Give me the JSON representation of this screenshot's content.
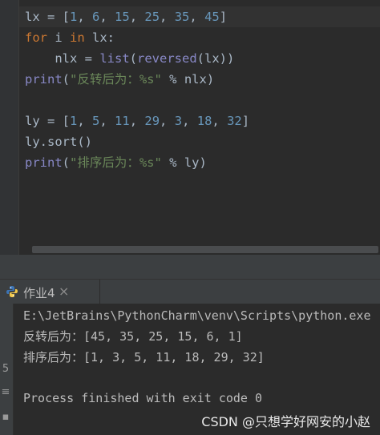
{
  "editor": {
    "lines": [
      {
        "tokens": [
          {
            "t": "lx = [",
            "c": ""
          },
          {
            "t": "1",
            "c": "num"
          },
          {
            "t": ", ",
            "c": ""
          },
          {
            "t": "6",
            "c": "num"
          },
          {
            "t": ", ",
            "c": ""
          },
          {
            "t": "15",
            "c": "num"
          },
          {
            "t": ", ",
            "c": ""
          },
          {
            "t": "25",
            "c": "num"
          },
          {
            "t": ", ",
            "c": ""
          },
          {
            "t": "35",
            "c": "num"
          },
          {
            "t": ", ",
            "c": ""
          },
          {
            "t": "45",
            "c": "num"
          },
          {
            "t": "]",
            "c": ""
          }
        ]
      },
      {
        "tokens": [
          {
            "t": "for",
            "c": "kw"
          },
          {
            "t": " i ",
            "c": ""
          },
          {
            "t": "in",
            "c": "kw"
          },
          {
            "t": " lx:",
            "c": ""
          }
        ]
      },
      {
        "tokens": [
          {
            "t": "    nlx = ",
            "c": ""
          },
          {
            "t": "list",
            "c": "fn"
          },
          {
            "t": "(",
            "c": ""
          },
          {
            "t": "reversed",
            "c": "fn"
          },
          {
            "t": "(lx))",
            "c": ""
          }
        ]
      },
      {
        "tokens": [
          {
            "t": "print",
            "c": "fn"
          },
          {
            "t": "(",
            "c": ""
          },
          {
            "t": "\"反转后为：%s\"",
            "c": "str"
          },
          {
            "t": " % nlx)",
            "c": ""
          }
        ]
      },
      {
        "tokens": []
      },
      {
        "tokens": [
          {
            "t": "ly = [",
            "c": ""
          },
          {
            "t": "1",
            "c": "num"
          },
          {
            "t": ", ",
            "c": ""
          },
          {
            "t": "5",
            "c": "num"
          },
          {
            "t": ", ",
            "c": ""
          },
          {
            "t": "11",
            "c": "num"
          },
          {
            "t": ", ",
            "c": ""
          },
          {
            "t": "29",
            "c": "num"
          },
          {
            "t": ", ",
            "c": ""
          },
          {
            "t": "3",
            "c": "num"
          },
          {
            "t": ", ",
            "c": ""
          },
          {
            "t": "18",
            "c": "num"
          },
          {
            "t": ", ",
            "c": ""
          },
          {
            "t": "32",
            "c": "num"
          },
          {
            "t": "]",
            "c": ""
          }
        ]
      },
      {
        "tokens": [
          {
            "t": "ly.sort()",
            "c": ""
          }
        ]
      },
      {
        "tokens": [
          {
            "t": "print",
            "c": "fn"
          },
          {
            "t": "(",
            "c": ""
          },
          {
            "t": "\"排序后为：%s\"",
            "c": "str"
          },
          {
            "t": " % ly)",
            "c": ""
          }
        ]
      }
    ]
  },
  "run_panel": {
    "tab_label": "作业4",
    "tab_close": "×",
    "output_lines": [
      "E:\\JetBrains\\PythonCharm\\venv\\Scripts\\python.exe",
      "反转后为：[45, 35, 25, 15, 6, 1]",
      "排序后为：[1, 3, 5, 11, 18, 29, 32]",
      "",
      "Process finished with exit code 0"
    ],
    "left_icons": [
      "5",
      "≡",
      "▪"
    ]
  },
  "watermark": "CSDN @只想学好网安的小赵",
  "colors": {
    "editor_bg": "#2b2b2b",
    "keyword": "#cc7832",
    "number": "#6897bb",
    "string": "#6a8759",
    "builtin": "#8888c6",
    "text": "#a9b7c6"
  }
}
